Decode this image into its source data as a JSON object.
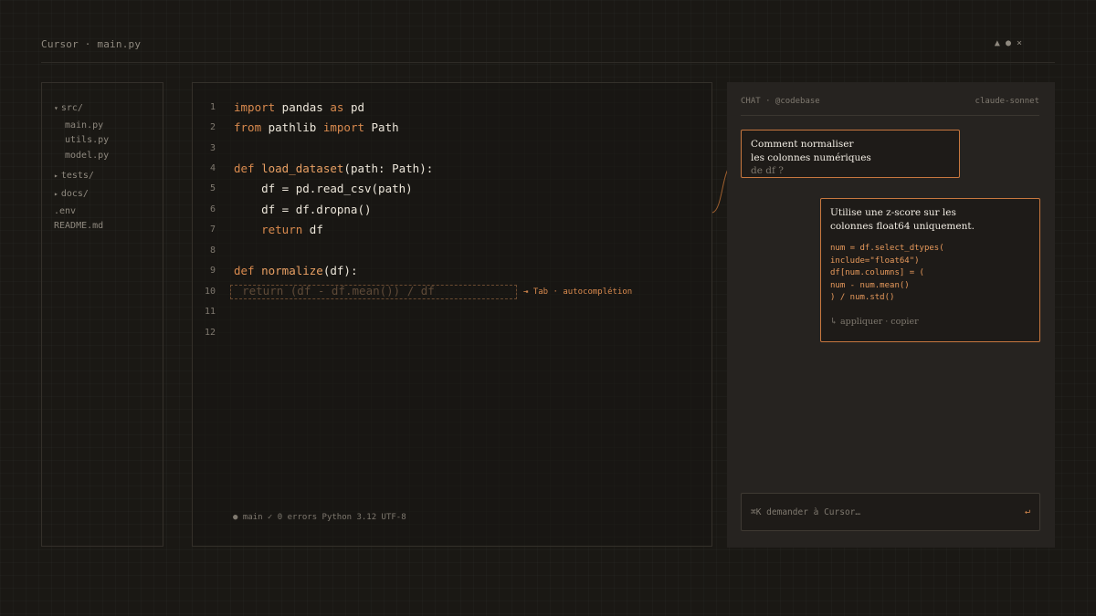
{
  "window": {
    "title": "Cursor · main.py",
    "controls": [
      "▲",
      "●",
      "×"
    ]
  },
  "sidebar": {
    "items": [
      {
        "label": "src/",
        "caret": "▾"
      },
      {
        "label": "main.py"
      },
      {
        "label": "utils.py"
      },
      {
        "label": "model.py"
      },
      {
        "label": "tests/",
        "caret": "▸"
      },
      {
        "label": "docs/",
        "caret": "▸"
      },
      {
        "label": ".env"
      },
      {
        "label": "README.md"
      }
    ]
  },
  "editor": {
    "line_numbers": [
      "1",
      "2",
      "3",
      "4",
      "5",
      "6",
      "7",
      "8",
      "9",
      "10",
      "11",
      "12"
    ],
    "lines": {
      "l1": {
        "kw1": "import",
        "t1": " pandas ",
        "kw2": "as",
        "t2": " pd"
      },
      "l2": {
        "kw1": "from",
        "t1": " pathlib ",
        "kw2": "import",
        "t2": " Path"
      },
      "l4": {
        "kw1": "def",
        "fn": " load_dataset",
        "t1": "(path: Path):"
      },
      "l5": {
        "t1": "    df = pd.read_csv(path)"
      },
      "l6": {
        "t1": "    df = df.dropna()"
      },
      "l7": {
        "kw1": "    return",
        "t1": " df"
      },
      "l9": {
        "kw1": "def",
        "fn": " normalize",
        "t1": "(df):"
      },
      "l10": {
        "ghost": "    return (df - df.mean()) / df"
      }
    },
    "autocomplete_hint": "⇥ Tab · autocomplétion",
    "status": "● main  ✓ 0 errors  Python 3.12  UTF-8"
  },
  "chat": {
    "header_left": "CHAT · @codebase",
    "header_right": "claude-sonnet",
    "user_message": {
      "line1": "Comment normaliser",
      "line2": "les colonnes numériques",
      "line3": "de df ?"
    },
    "assistant_message": {
      "line1": "Utilise une z-score sur les",
      "line2": "colonnes float64 uniquement.",
      "code": "num = df.select_dtypes(\ninclude=\"float64\")\ndf[num.columns] = (\nnum - num.mean()\n) / num.std()",
      "actions": "↳ appliquer · copier"
    },
    "input_placeholder": "⌘K demander à Cursor…",
    "send_icon": "↵"
  },
  "colors": {
    "accent": "#d98a4e",
    "background": "#1a1814",
    "panel": "#262320"
  }
}
